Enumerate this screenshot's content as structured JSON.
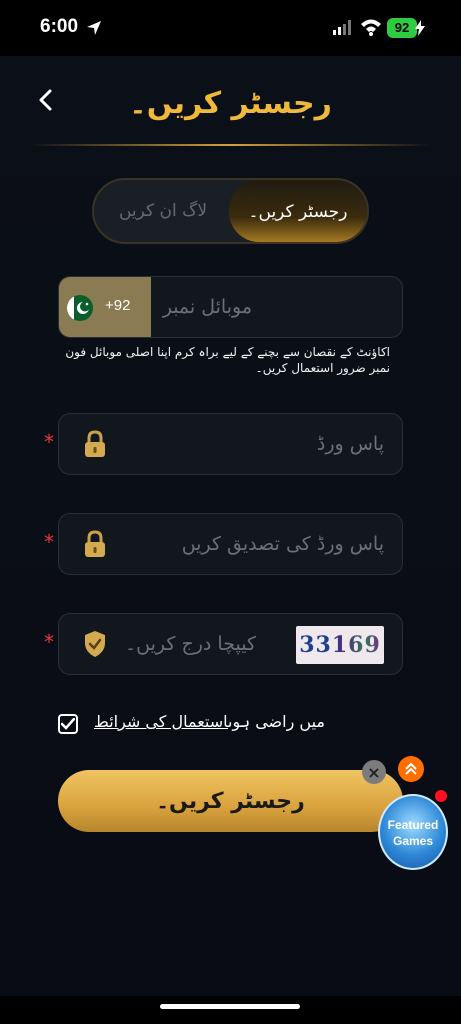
{
  "status_bar": {
    "time": "6:00",
    "battery": "92"
  },
  "header": {
    "title": "رجسٹر کریں۔"
  },
  "tabs": {
    "register": "رجسٹر کریں۔",
    "login": "لاگ ان کریں"
  },
  "form": {
    "country_code": "+92",
    "mobile_placeholder": "موبائل نمبر",
    "mobile_hint": "اکاؤنٹ کے نقصان سے بچنے کے لیے براہ کرم اپنا اصلی موبائل فون نمبر ضرور استعمال کریں۔",
    "required_mark": "*",
    "password_placeholder": "پاس ورڈ",
    "confirm_password_placeholder": "پاس ورڈ کی تصدیق کریں",
    "captcha_placeholder": "کیپچا درج کریں۔",
    "captcha_code": "33169",
    "terms_prefix": "میں راضی ہوں",
    "terms_link": "استعمال کی شرائط",
    "terms_checked": true,
    "submit": "رجسٹر کریں۔"
  },
  "floating": {
    "close": "×",
    "badge_line1": "Featured",
    "badge_line2": "Games"
  },
  "colors": {
    "accent": "#f0b93a",
    "background": "#0b0f17",
    "required": "#e33b3b"
  }
}
